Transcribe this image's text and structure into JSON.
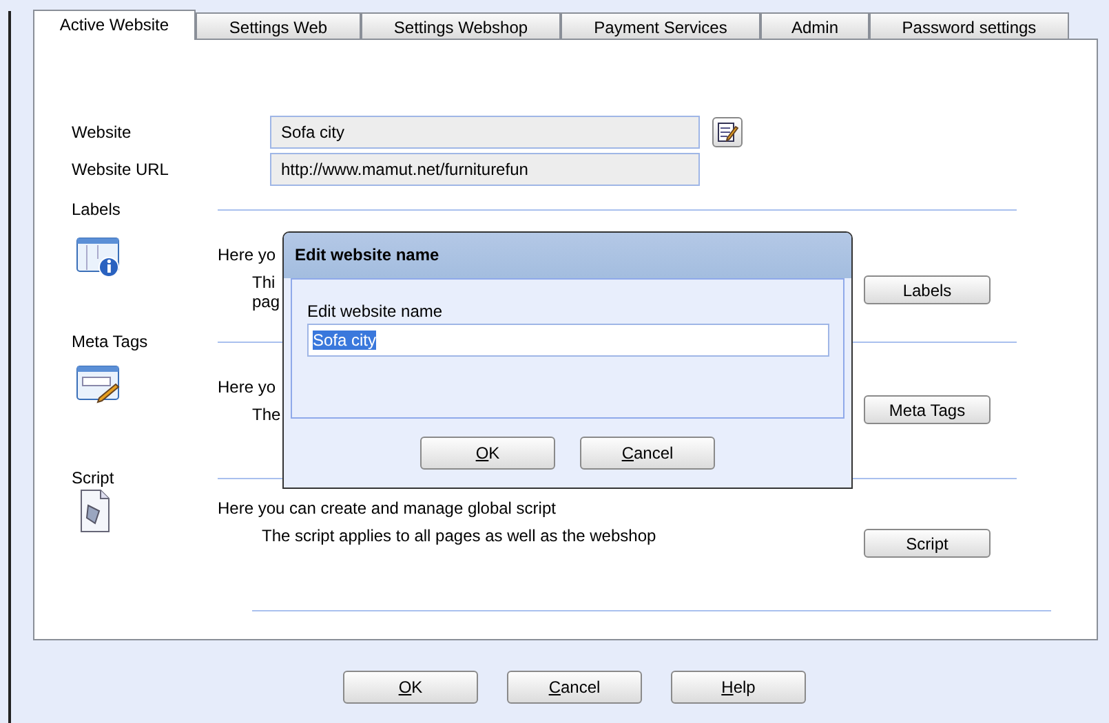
{
  "tabs": [
    {
      "label": "Active Website",
      "selected": true
    },
    {
      "label": "Settings Web",
      "selected": false
    },
    {
      "label": "Settings Webshop",
      "selected": false
    },
    {
      "label": "Payment Services",
      "selected": false
    },
    {
      "label": "Admin",
      "selected": false
    },
    {
      "label": "Password settings",
      "selected": false
    }
  ],
  "website": {
    "label": "Website",
    "value": "Sofa city"
  },
  "website_url": {
    "label": "Website URL",
    "value": "http://www.mamut.net/furniturefun"
  },
  "sections": [
    {
      "kind": "labels",
      "title": "Labels",
      "line1": "Here yo",
      "line2": "Thi",
      "line3": "pag",
      "button": "Labels"
    },
    {
      "kind": "meta",
      "title": "Meta Tags",
      "line1": "Here yo",
      "line2": "The",
      "button": "Meta Tags"
    },
    {
      "kind": "script",
      "title": "Script",
      "line1": "Here you can create and manage global script",
      "line2": "The script applies to all pages as well as the webshop",
      "button": "Script"
    }
  ],
  "buttons": [
    {
      "label": "OK"
    },
    {
      "label": "Cancel"
    },
    {
      "label": "Help"
    }
  ],
  "dialog": {
    "title": "Edit website name",
    "field_label": "Edit website name",
    "value": "Sofa city",
    "buttons": [
      {
        "label": "OK"
      },
      {
        "label": "Cancel"
      }
    ]
  }
}
